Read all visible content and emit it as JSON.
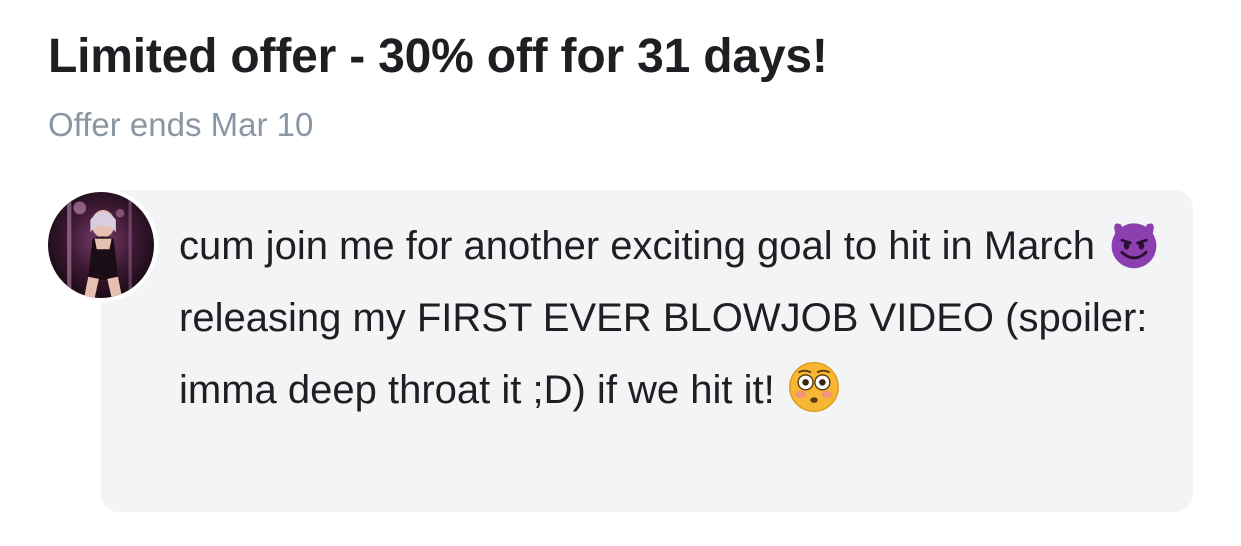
{
  "offer": {
    "title": "Limited offer - 30% off for 31 days!",
    "subtitle": "Offer ends Mar 10"
  },
  "post": {
    "text_part_1": "cum join me for another exciting goal to hit in March",
    "emoji_1": "smiling-face-with-horns-icon",
    "text_part_2": "releasing my FIRST EVER BLOWJOB VIDEO (spoiler: imma deep throat it ;D) if we hit it!",
    "emoji_2": "flushed-face-icon"
  },
  "colors": {
    "title": "#1d1f22",
    "subtitle": "#8a96a3",
    "bubble_background": "#f3f4f6",
    "devil_emoji": "#8b3fb0",
    "flushed_emoji": "#f7b733"
  }
}
